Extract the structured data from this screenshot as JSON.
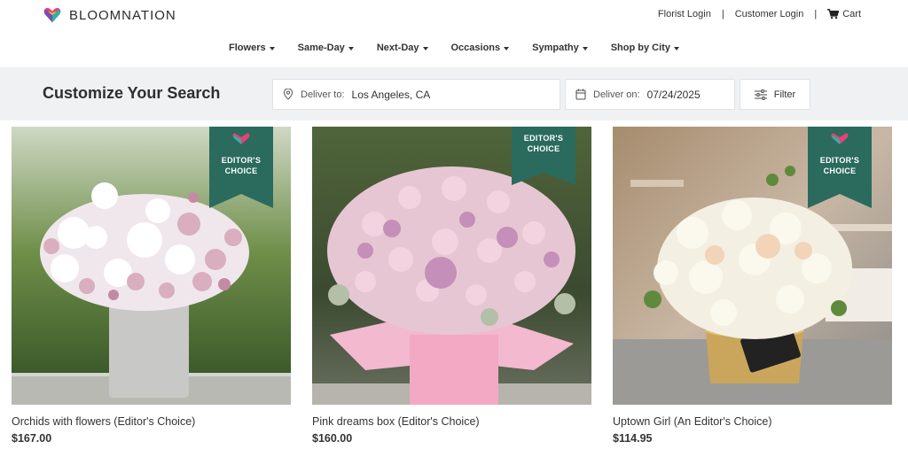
{
  "brand": {
    "name": "BLOOMNATION"
  },
  "top_links": {
    "florist_login": "Florist Login",
    "customer_login": "Customer Login",
    "cart": "Cart",
    "separator": "|"
  },
  "nav": {
    "items": [
      {
        "label": "Flowers"
      },
      {
        "label": "Same-Day"
      },
      {
        "label": "Next-Day"
      },
      {
        "label": "Occasions"
      },
      {
        "label": "Sympathy"
      },
      {
        "label": "Shop by City"
      }
    ]
  },
  "search": {
    "title": "Customize Your Search",
    "deliver_to_label": "Deliver to:",
    "deliver_to_value": "Los Angeles, CA",
    "deliver_on_label": "Deliver on:",
    "deliver_on_value": "07/24/2025",
    "filter_label": "Filter"
  },
  "badge": {
    "line1": "EDITOR'S",
    "line2": "CHOICE"
  },
  "products": [
    {
      "title": "Orchids with flowers (Editor's Choice)",
      "price": "$167.00"
    },
    {
      "title": "Pink dreams box (Editor's Choice)",
      "price": "$160.00"
    },
    {
      "title": "Uptown Girl (An Editor's Choice)",
      "price": "$114.95"
    }
  ],
  "colors": {
    "badge_green": "#2a6b5e",
    "strip_bg": "#f0f1f3",
    "text": "#333333"
  },
  "icons": {
    "location": "map-pin-icon",
    "calendar": "calendar-icon",
    "filter": "sliders-icon",
    "cart": "cart-icon"
  }
}
